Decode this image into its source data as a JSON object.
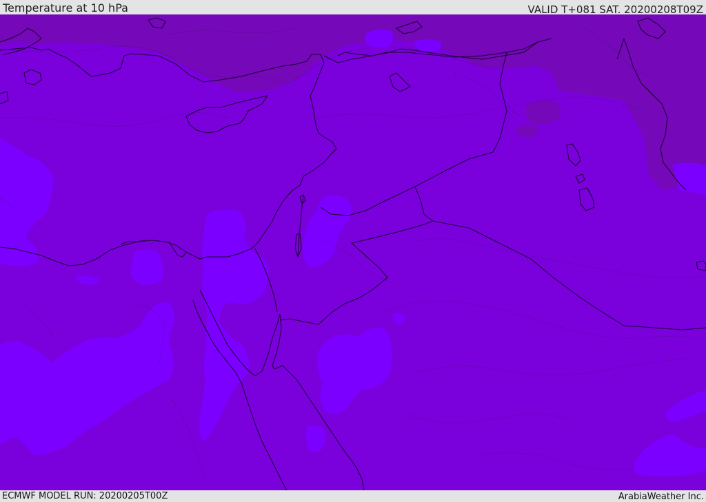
{
  "header": {
    "title": "Temperature at 10 hPa",
    "valid": "VALID T+081 SAT. 20200208T09Z"
  },
  "footer": {
    "model_run": "ECMWF MODEL RUN: 20200205T00Z",
    "credit": "ArabiaWeather Inc."
  },
  "colors": {
    "base_field": "#7a00dc",
    "cold_field": "#7508b8",
    "warm_field": "#7c00ff",
    "coastline": "#1a0030",
    "contour": "#4a0a80",
    "bar_background": "#e4e4e4"
  }
}
